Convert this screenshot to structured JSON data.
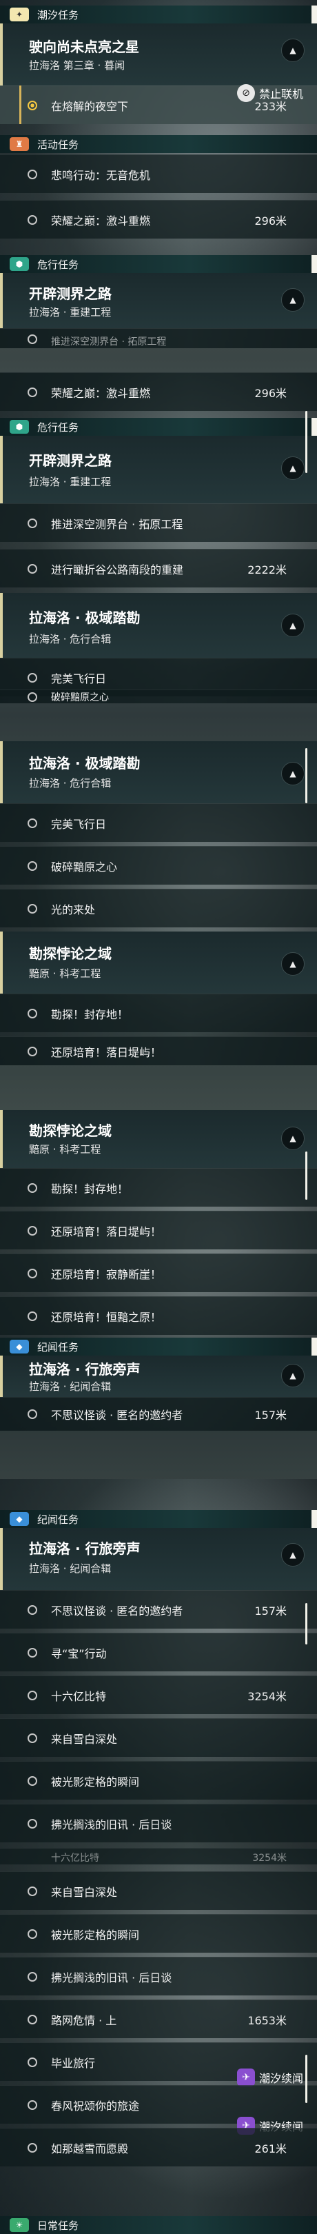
{
  "cats": {
    "tide": "潮汐任务",
    "activity": "活动任务",
    "danger": "危行任务",
    "chronicle": "纪闻任务",
    "daily": "日常任务"
  },
  "s1": {
    "card_title": "驶向尚未点亮之星",
    "card_sub": "拉海洛 第三章 · 暮闻",
    "task_active": "在熔解的夜空下",
    "task_active_dist": "233米",
    "disable_label": "禁止联机",
    "act_tasks": [
      {
        "t": "悲鸣行动：无音危机",
        "d": ""
      },
      {
        "t": "荣耀之巅：激斗重燃",
        "d": "296米"
      }
    ],
    "card2_title": "开辟测界之路",
    "card2_sub": "拉海洛 · 重建工程",
    "cut_task": "推进深空测界台 · 拓原工程"
  },
  "s2": {
    "task_top": {
      "t": "荣耀之巅：激斗重燃",
      "d": "296米"
    },
    "card_title": "开辟测界之路",
    "card_sub": "拉海洛 · 重建工程",
    "tasks": [
      {
        "t": "推进深空测界台 · 拓原工程",
        "d": ""
      },
      {
        "t": "进行瞰折谷公路南段的重建",
        "d": "2222米"
      }
    ],
    "card2_title": "拉海洛 · 极域踏勘",
    "card2_sub": "拉海洛 · 危行合辑",
    "tasks2": [
      {
        "t": "完美飞行日",
        "d": ""
      },
      {
        "t": "破碎黯原之心",
        "d": ""
      }
    ]
  },
  "s3": {
    "card_title": "拉海洛 · 极域踏勘",
    "card_sub": "拉海洛 · 危行合辑",
    "tasks": [
      {
        "t": "完美飞行日",
        "d": ""
      },
      {
        "t": "破碎黯原之心",
        "d": ""
      },
      {
        "t": "光的来处",
        "d": ""
      }
    ],
    "card2_title": "勘探悖论之域",
    "card2_sub": "黯原 · 科考工程",
    "tasks2": [
      {
        "t": "勘探！封存地！",
        "d": ""
      },
      {
        "t": "还原培育！落日堤屿！",
        "d": ""
      }
    ]
  },
  "s4": {
    "card_title": "勘探悖论之域",
    "card_sub": "黯原 · 科考工程",
    "tasks": [
      {
        "t": "勘探！封存地！",
        "d": ""
      },
      {
        "t": "还原培育！落日堤屿！",
        "d": ""
      },
      {
        "t": "还原培育！寂静断崖！",
        "d": ""
      },
      {
        "t": "还原培育！恒黯之原！",
        "d": ""
      }
    ],
    "card2_title": "拉海洛 · 行旅旁声",
    "card2_sub": "拉海洛 · 纪闻合辑",
    "tasks2": [
      {
        "t": "不思议怪谈 · 匿名的邀约者",
        "d": "157米"
      }
    ]
  },
  "s5": {
    "card_title": "拉海洛 · 行旅旁声",
    "card_sub": "拉海洛 · 纪闻合辑",
    "tasks": [
      {
        "t": "不思议怪谈 · 匿名的邀约者",
        "d": "157米"
      },
      {
        "t": "寻“宝”行动",
        "d": ""
      },
      {
        "t": "十六亿比特",
        "d": "3254米"
      },
      {
        "t": "来自雪白深处",
        "d": ""
      },
      {
        "t": "被光影定格的瞬间",
        "d": ""
      },
      {
        "t": "拂光搁浅的旧讯 · 后日谈",
        "d": ""
      }
    ]
  },
  "s6": {
    "cut_task": {
      "t": "十六亿比特",
      "d": "3254米"
    },
    "tasks": [
      {
        "t": "来自雪白深处",
        "d": ""
      },
      {
        "t": "被光影定格的瞬间",
        "d": ""
      },
      {
        "t": "拂光搁浅的旧讯 · 后日谈",
        "d": ""
      },
      {
        "t": "路网危情 · 上",
        "d": "1653米"
      },
      {
        "t": "毕业旅行",
        "d": ""
      },
      {
        "t": "春风祝颂你的旅途",
        "d": ""
      },
      {
        "t": "如那越雪而愿殿",
        "d": "261米"
      }
    ],
    "tag_label": "潮汐续闻"
  },
  "colors": {
    "tide_badge": "#f3e7b0",
    "activity_badge": "#e07a45",
    "danger_badge": "#2fa58a",
    "chronicle_badge": "#3a8fd8",
    "daily_badge": "#3aaa6e",
    "tag_icon": "#8a4fd0",
    "disable_icon": "#e8e8e8"
  },
  "icons": {
    "tide": "star-icon",
    "activity": "trophy-icon",
    "danger": "hex-icon",
    "chronicle": "diamond-icon",
    "daily": "sun-icon",
    "toggle": "chevron-up-icon",
    "tag": "bird-icon"
  }
}
